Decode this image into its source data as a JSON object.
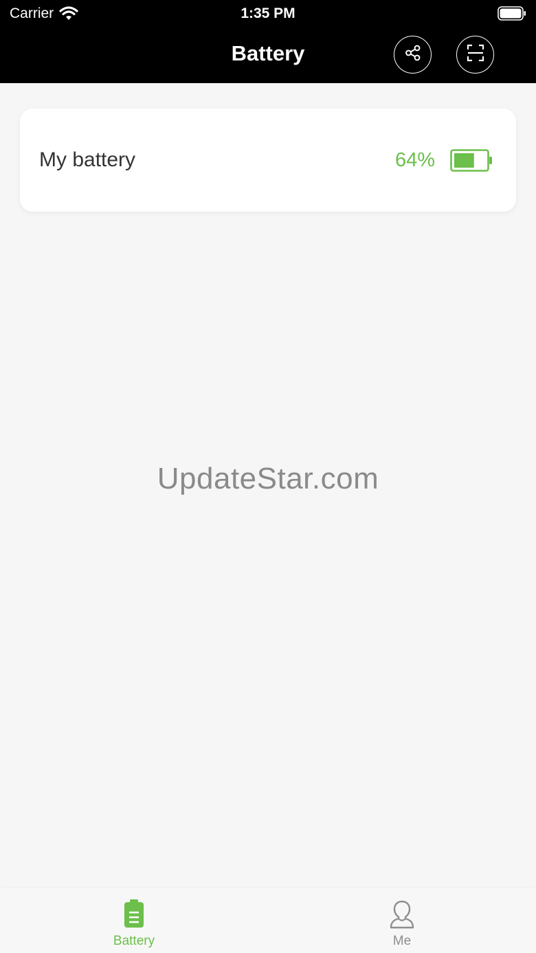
{
  "status_bar": {
    "carrier": "Carrier",
    "time": "1:35 PM",
    "icons": [
      "wifi-icon",
      "battery-status-icon"
    ]
  },
  "nav": {
    "title": "Battery",
    "actions": [
      {
        "name": "share",
        "icon": "share-icon"
      },
      {
        "name": "scan",
        "icon": "scan-icon"
      }
    ]
  },
  "battery_card": {
    "label": "My battery",
    "percent_text": "64%",
    "level": 0.64,
    "icon": "battery-level-icon"
  },
  "watermark": "UpdateStar.com",
  "tab_bar": {
    "tabs": [
      {
        "label": "Battery",
        "icon": "battery-tab-icon",
        "active": true
      },
      {
        "label": "Me",
        "icon": "person-icon",
        "active": false
      }
    ]
  },
  "colors": {
    "accent": "#6cbf4a",
    "header_bg": "#000000",
    "page_bg": "#f6f6f6",
    "inactive": "#8e8e8e"
  }
}
